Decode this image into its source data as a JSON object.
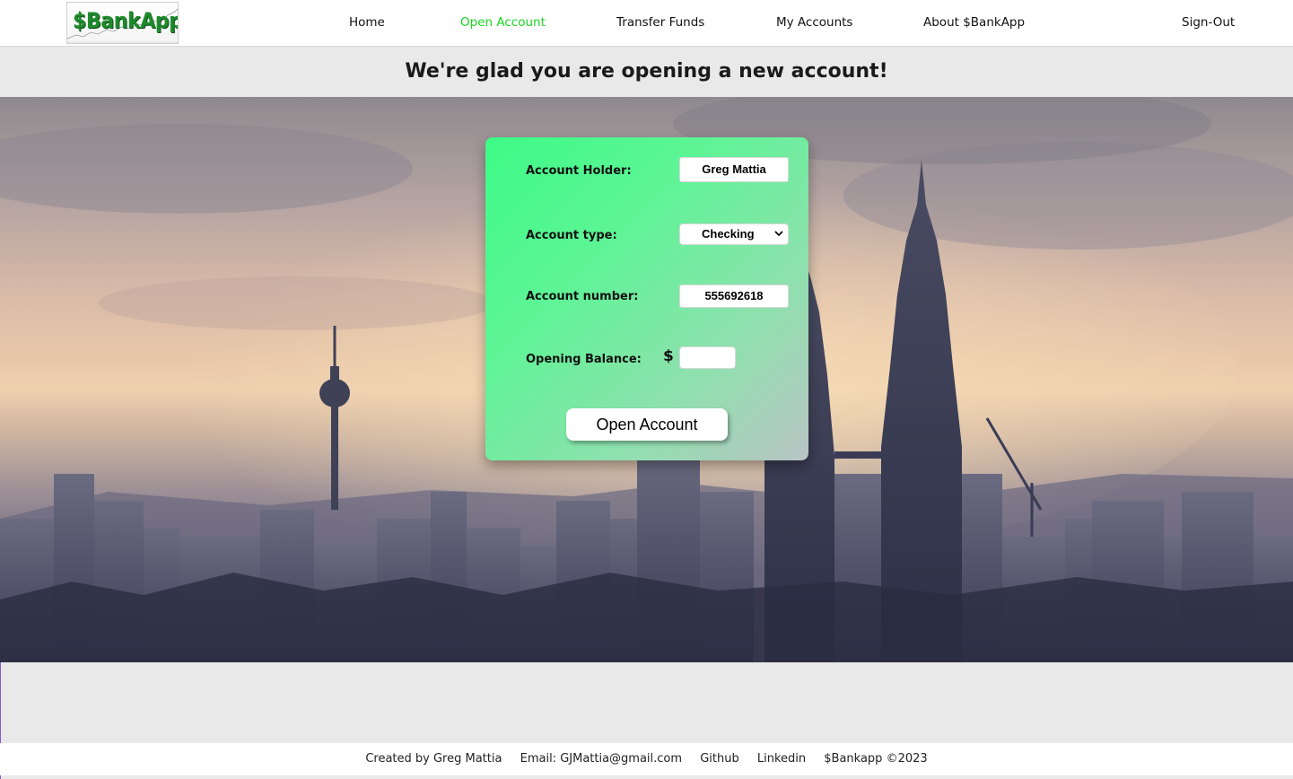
{
  "nav": {
    "logo_text": "$BankApp",
    "links": [
      {
        "label": "Home"
      },
      {
        "label": "Open Account"
      },
      {
        "label": "Transfer Funds"
      },
      {
        "label": "My Accounts"
      },
      {
        "label": "About $BankApp"
      }
    ],
    "signout_label": "Sign-Out",
    "active_color": "#18d61f"
  },
  "banner": {
    "title": "We're glad you are opening a new account!"
  },
  "form": {
    "holder_label": "Account Holder:",
    "holder_value": "Greg Mattia",
    "type_label": "Account type:",
    "type_value": "Checking",
    "number_label": "Account number:",
    "number_value": "555692618",
    "balance_label": "Opening Balance:",
    "currency_symbol": "$",
    "balance_value": "",
    "submit_label": "Open Account",
    "card_colors": [
      "#3dfb86",
      "#b9c4c4"
    ]
  },
  "footer": {
    "created_by": "Created by Greg Mattia",
    "email": "Email: GJMattia@gmail.com",
    "github": "Github",
    "linkedin": "Linkedin",
    "copyright": "$Bankapp ©2023"
  }
}
